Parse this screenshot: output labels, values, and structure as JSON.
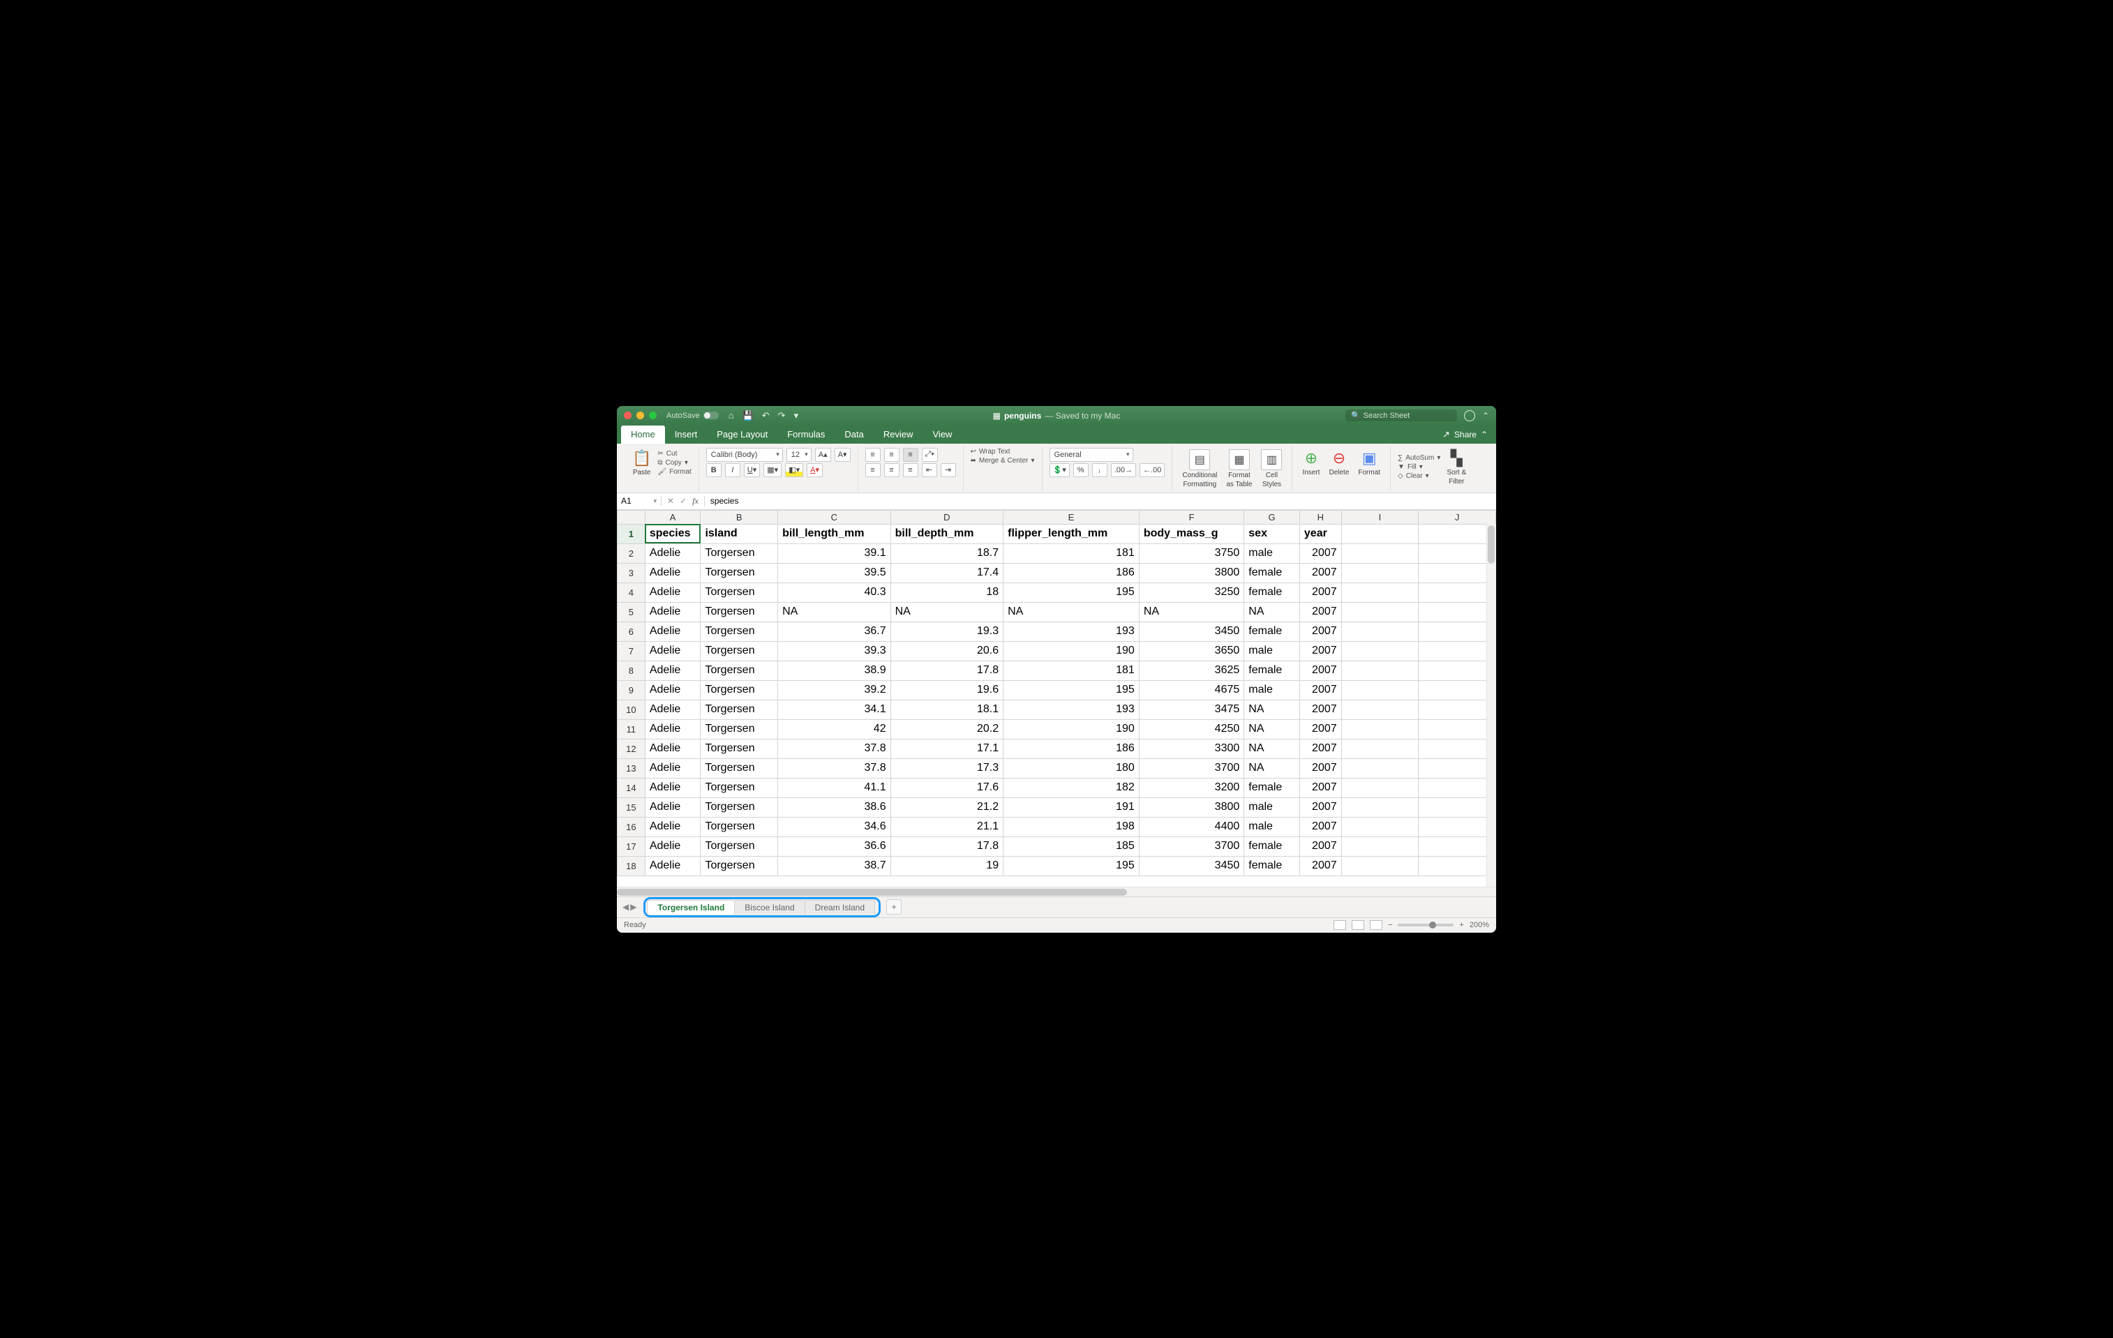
{
  "title": {
    "autosave": "AutoSave",
    "doc": "penguins",
    "sub": "— Saved to my Mac",
    "search_ph": "Search Sheet"
  },
  "menu": {
    "tabs": [
      "Home",
      "Insert",
      "Page Layout",
      "Formulas",
      "Data",
      "Review",
      "View"
    ],
    "share": "Share"
  },
  "ribbon": {
    "paste": "Paste",
    "cut": "Cut",
    "copy": "Copy",
    "format": "Format",
    "font_name": "Calibri (Body)",
    "font_size": "12",
    "wrap": "Wrap Text",
    "merge": "Merge & Center",
    "num_format": "General",
    "cond": "Conditional",
    "cond2": "Formatting",
    "fast": "Format",
    "fast2": "as Table",
    "styles": "Cell",
    "styles2": "Styles",
    "insert": "Insert",
    "delete": "Delete",
    "formatc": "Format",
    "autosum": "AutoSum",
    "fill": "Fill",
    "clear": "Clear",
    "sort": "Sort &",
    "sort2": "Filter"
  },
  "fbar": {
    "cell": "A1",
    "formula": "species"
  },
  "sheet": {
    "columns": [
      "A",
      "B",
      "C",
      "D",
      "E",
      "F",
      "G",
      "H",
      "I",
      "J"
    ],
    "headers": [
      "species",
      "island",
      "bill_length_mm",
      "bill_depth_mm",
      "flipper_length_mm",
      "body_mass_g",
      "sex",
      "year"
    ],
    "numeric": [
      false,
      false,
      true,
      true,
      true,
      true,
      false,
      true
    ],
    "rows": [
      [
        "Adelie",
        "Torgersen",
        "39.1",
        "18.7",
        "181",
        "3750",
        "male",
        "2007"
      ],
      [
        "Adelie",
        "Torgersen",
        "39.5",
        "17.4",
        "186",
        "3800",
        "female",
        "2007"
      ],
      [
        "Adelie",
        "Torgersen",
        "40.3",
        "18",
        "195",
        "3250",
        "female",
        "2007"
      ],
      [
        "Adelie",
        "Torgersen",
        "NA",
        "NA",
        "NA",
        "NA",
        "NA",
        "2007"
      ],
      [
        "Adelie",
        "Torgersen",
        "36.7",
        "19.3",
        "193",
        "3450",
        "female",
        "2007"
      ],
      [
        "Adelie",
        "Torgersen",
        "39.3",
        "20.6",
        "190",
        "3650",
        "male",
        "2007"
      ],
      [
        "Adelie",
        "Torgersen",
        "38.9",
        "17.8",
        "181",
        "3625",
        "female",
        "2007"
      ],
      [
        "Adelie",
        "Torgersen",
        "39.2",
        "19.6",
        "195",
        "4675",
        "male",
        "2007"
      ],
      [
        "Adelie",
        "Torgersen",
        "34.1",
        "18.1",
        "193",
        "3475",
        "NA",
        "2007"
      ],
      [
        "Adelie",
        "Torgersen",
        "42",
        "20.2",
        "190",
        "4250",
        "NA",
        "2007"
      ],
      [
        "Adelie",
        "Torgersen",
        "37.8",
        "17.1",
        "186",
        "3300",
        "NA",
        "2007"
      ],
      [
        "Adelie",
        "Torgersen",
        "37.8",
        "17.3",
        "180",
        "3700",
        "NA",
        "2007"
      ],
      [
        "Adelie",
        "Torgersen",
        "41.1",
        "17.6",
        "182",
        "3200",
        "female",
        "2007"
      ],
      [
        "Adelie",
        "Torgersen",
        "38.6",
        "21.2",
        "191",
        "3800",
        "male",
        "2007"
      ],
      [
        "Adelie",
        "Torgersen",
        "34.6",
        "21.1",
        "198",
        "4400",
        "male",
        "2007"
      ],
      [
        "Adelie",
        "Torgersen",
        "36.6",
        "17.8",
        "185",
        "3700",
        "female",
        "2007"
      ],
      [
        "Adelie",
        "Torgersen",
        "38.7",
        "19",
        "195",
        "3450",
        "female",
        "2007"
      ]
    ]
  },
  "tabs": [
    "Torgersen Island",
    "Biscoe Island",
    "Dream Island"
  ],
  "status": {
    "ready": "Ready",
    "zoom": "200%"
  }
}
